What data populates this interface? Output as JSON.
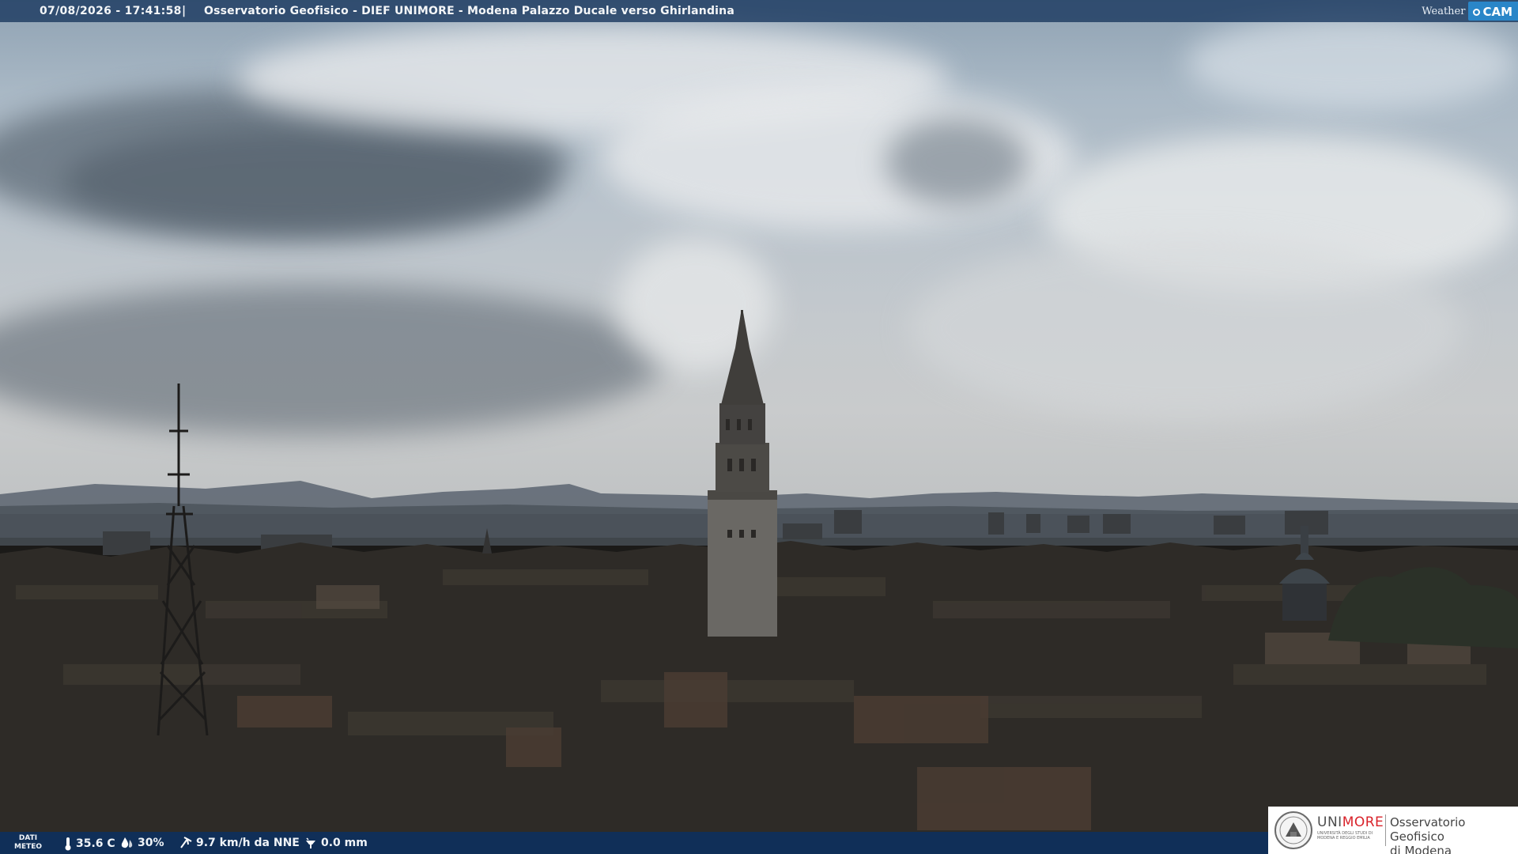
{
  "topbar": {
    "timestamp": "07/08/2026 - 17:41:58",
    "separator": "|",
    "title": "Osservatorio Geofisico - DIEF UNIMORE - Modena Palazzo Ducale verso Ghirlandina",
    "brand_weather": "Weather",
    "brand_cam": "CAM",
    "background": "#16345c"
  },
  "scene": {
    "sky_color": "#b9c3cc",
    "mountain_color": "#5b6470",
    "city_color": "#2a2724",
    "tower_color": "#3a3835"
  },
  "meteo": {
    "label_line1": "DATI",
    "label_line2": "METEO",
    "temperature": "35.6 C",
    "humidity": "30%",
    "wind": "9.7 km/h da NNE",
    "rain": "0.0 mm",
    "icons": [
      "thermometer-icon",
      "humidity-drop-icon",
      "wind-icon",
      "rain-gauge-icon"
    ],
    "background": "#0a3062"
  },
  "logo": {
    "uni_prefix": "UNI",
    "uni_accent": "MORE",
    "uni_subtitle": "UNIVERSITÀ DEGLI STUDI DI MODENA E REGGIO EMILIA",
    "observatory_line1": "Osservatorio Geofisico",
    "observatory_line2": "di Modena",
    "accent_color": "#d9222a"
  }
}
